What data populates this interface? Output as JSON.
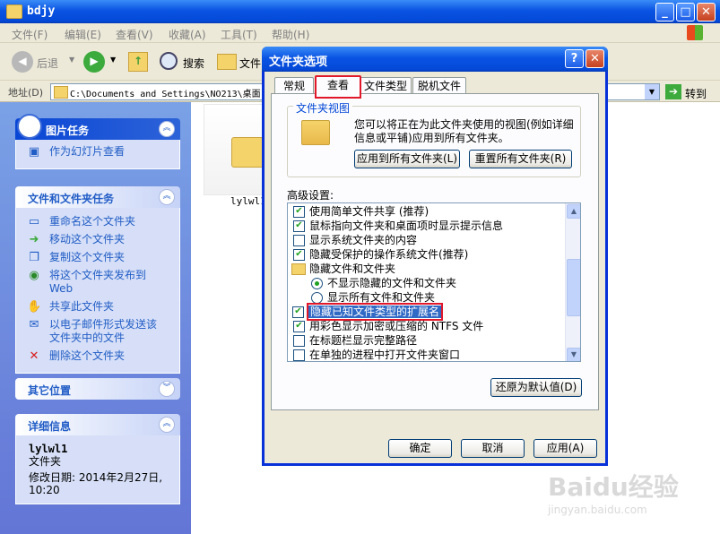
{
  "explorer": {
    "title": "bdjy",
    "menus": [
      "文件(F)",
      "编辑(E)",
      "查看(V)",
      "收藏(A)",
      "工具(T)",
      "帮助(H)"
    ],
    "toolbar": {
      "back": "后退",
      "search": "搜索",
      "folders": "文件"
    },
    "address_label": "地址(D)",
    "address_value": "C:\\Documents and Settings\\NO213\\桌面",
    "go_label": "转到",
    "folder_name": "lylwl1"
  },
  "left": {
    "picture_tasks": {
      "title": "图片任务",
      "items": [
        "作为幻灯片查看"
      ]
    },
    "folder_tasks": {
      "title": "文件和文件夹任务",
      "items": [
        "重命名这个文件夹",
        "移动这个文件夹",
        "复制这个文件夹",
        "将这个文件夹发布到",
        "Web",
        "共享此文件夹",
        "以电子邮件形式发送该",
        "文件夹中的文件",
        "删除这个文件夹"
      ]
    },
    "other_places": {
      "title": "其它位置"
    },
    "details": {
      "title": "详细信息",
      "name": "lylwl1",
      "type": "文件夹",
      "modified_label": "修改日期: 2014年2月27日,",
      "modified_time": "10:20"
    }
  },
  "dialog": {
    "title": "文件夹选项",
    "tabs": [
      "常规",
      "查看",
      "文件类型",
      "脱机文件"
    ],
    "folder_views_label": "文件夹视图",
    "folder_views_desc1": "您可以将正在为此文件夹使用的视图(例如详细",
    "folder_views_desc2": "信息或平铺)应用到所有文件夹。",
    "apply_all": "应用到所有文件夹(L)",
    "reset_all": "重置所有文件夹(R)",
    "advanced_label": "高级设置:",
    "settings": [
      {
        "type": "check",
        "checked": true,
        "label": "使用简单文件共享 (推荐)"
      },
      {
        "type": "check",
        "checked": true,
        "label": "鼠标指向文件夹和桌面项时显示提示信息"
      },
      {
        "type": "check",
        "checked": false,
        "label": "显示系统文件夹的内容"
      },
      {
        "type": "check",
        "checked": true,
        "label": "隐藏受保护的操作系统文件(推荐)"
      },
      {
        "type": "folder",
        "label": "隐藏文件和文件夹"
      },
      {
        "type": "radio",
        "checked": true,
        "label": "不显示隐藏的文件和文件夹"
      },
      {
        "type": "radio",
        "checked": false,
        "label": "显示所有文件和文件夹"
      },
      {
        "type": "check",
        "checked": true,
        "label": "隐藏已知文件类型的扩展名",
        "selected": true
      },
      {
        "type": "check",
        "checked": true,
        "label": "用彩色显示加密或压缩的 NTFS 文件"
      },
      {
        "type": "check",
        "checked": false,
        "label": "在标题栏显示完整路径"
      },
      {
        "type": "check",
        "checked": false,
        "label": "在单独的进程中打开文件夹窗口"
      }
    ],
    "restore_defaults": "还原为默认值(D)",
    "ok": "确定",
    "cancel": "取消",
    "apply": "应用(A)"
  },
  "watermark": {
    "text": "Baidu经验",
    "sub": "jingyan.baidu.com"
  }
}
